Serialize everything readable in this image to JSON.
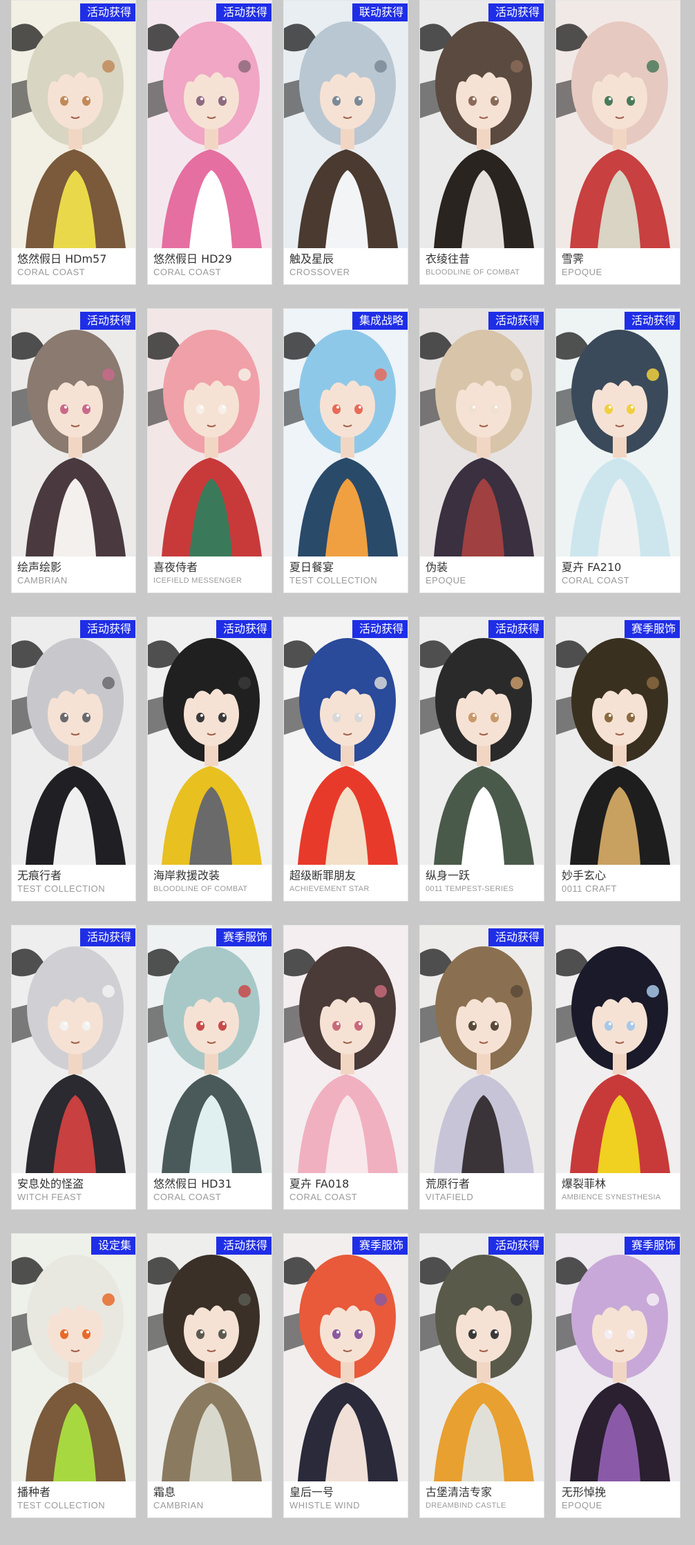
{
  "skins": [
    {
      "name": "悠然假日 HDm57",
      "series": "CORAL COAST",
      "tag": "活动获得",
      "palette": [
        "#f2efe4",
        "#d8d5c2",
        "#7a5a3a",
        "#e9d94a",
        "#c28a5a"
      ]
    },
    {
      "name": "悠然假日 HD29",
      "series": "CORAL COAST",
      "tag": "活动获得",
      "palette": [
        "#f4e8ee",
        "#f0a6c4",
        "#e56fa0",
        "#ffffff",
        "#8e6a7e"
      ]
    },
    {
      "name": "触及星辰",
      "series": "CROSSOVER",
      "tag": "联动获得",
      "palette": [
        "#e8eef2",
        "#b9c7d2",
        "#4a3a30",
        "#f2f4f6",
        "#7b8a98"
      ]
    },
    {
      "name": "衣绫往昔",
      "series": "BLOODLINE OF COMBAT",
      "tag": "活动获得",
      "palette": [
        "#eaeaea",
        "#5a4a40",
        "#2a2420",
        "#e8e2de",
        "#8a6a58"
      ]
    },
    {
      "name": "雪霁",
      "series": "EPOQUE",
      "tag": "",
      "palette": [
        "#f1e9e6",
        "#e6c9c0",
        "#c84040",
        "#d9d4c4",
        "#4a7a5a"
      ]
    },
    {
      "name": "绘声绘影",
      "series": "CAMBRIAN",
      "tag": "活动获得",
      "palette": [
        "#ecebea",
        "#8a7a70",
        "#4a3a40",
        "#f4f0ee",
        "#c86a8a"
      ]
    },
    {
      "name": "喜夜侍者",
      "series": "ICEFIELD MESSENGER",
      "tag": "",
      "palette": [
        "#f3e6e6",
        "#f0a0a8",
        "#c83a3a",
        "#3a7a5a",
        "#f6f0e8"
      ]
    },
    {
      "name": "夏日餐宴",
      "series": "TEST COLLECTION",
      "tag": "集成战略",
      "palette": [
        "#eef4f8",
        "#8ec8e8",
        "#2a4a6a",
        "#f0a040",
        "#e86a5a"
      ]
    },
    {
      "name": "伪装",
      "series": "EPOQUE",
      "tag": "活动获得",
      "palette": [
        "#e6e3e2",
        "#d8c4a8",
        "#3a3040",
        "#a04040",
        "#f0e0d0"
      ]
    },
    {
      "name": "夏卉 FA210",
      "series": "CORAL COAST",
      "tag": "活动获得",
      "palette": [
        "#eef4f4",
        "#3a4a5a",
        "#cde6ee",
        "#f2f2f2",
        "#f0d040"
      ]
    },
    {
      "name": "无痕行者",
      "series": "TEST COLLECTION",
      "tag": "活动获得",
      "palette": [
        "#ededed",
        "#c8c8cc",
        "#202024",
        "#f0f0f0",
        "#6a6a6e"
      ]
    },
    {
      "name": "海岸救援改装",
      "series": "BLOODLINE OF COMBAT",
      "tag": "活动获得",
      "palette": [
        "#f0f0f0",
        "#202020",
        "#e8c020",
        "#6a6a6a",
        "#3a3a3a"
      ]
    },
    {
      "name": "超级断罪朋友",
      "series": "ACHIEVEMENT STAR",
      "tag": "活动获得",
      "palette": [
        "#f4f4f4",
        "#2a4a9a",
        "#e83a2a",
        "#f4e0c8",
        "#d8d8d8"
      ]
    },
    {
      "name": "纵身一跃",
      "series": "0011 TEMPEST-SERIES",
      "tag": "活动获得",
      "palette": [
        "#eeeeee",
        "#2a2a2a",
        "#4a5a4a",
        "#ffffff",
        "#c89a6a"
      ]
    },
    {
      "name": "妙手玄心",
      "series": "0011 CRAFT",
      "tag": "赛季服饰",
      "palette": [
        "#ececec",
        "#3a3020",
        "#1e1e1e",
        "#c8a060",
        "#8a6a40"
      ]
    },
    {
      "name": "安息处的怪盗",
      "series": "WITCH FEAST",
      "tag": "活动获得",
      "palette": [
        "#eeeeee",
        "#d0d0d4",
        "#2a2a30",
        "#c84040",
        "#f2f2f2"
      ]
    },
    {
      "name": "悠然假日 HD31",
      "series": "CORAL COAST",
      "tag": "赛季服饰",
      "palette": [
        "#eef2f2",
        "#a8c8c8",
        "#4a5a5a",
        "#e0f0f0",
        "#c84a4a"
      ]
    },
    {
      "name": "夏卉 FA018",
      "series": "CORAL COAST",
      "tag": "",
      "palette": [
        "#f4eef0",
        "#4a3a38",
        "#f0b0c0",
        "#f8e8ec",
        "#c86a7a"
      ]
    },
    {
      "name": "荒原行者",
      "series": "VITAFIELD",
      "tag": "活动获得",
      "palette": [
        "#eeecea",
        "#8a7050",
        "#c8c4d8",
        "#3a3438",
        "#5a4a3a"
      ]
    },
    {
      "name": "爆裂菲林",
      "series": "AMBIENCE SYNESTHESIA",
      "tag": "",
      "palette": [
        "#f0eeee",
        "#1a1a2a",
        "#c83a3a",
        "#f0d020",
        "#a8c8e8"
      ]
    },
    {
      "name": "播种者",
      "series": "TEST COLLECTION",
      "tag": "设定集",
      "palette": [
        "#eef0ea",
        "#e8e8e0",
        "#7a5a3a",
        "#a8d840",
        "#e86a2a"
      ]
    },
    {
      "name": "霜息",
      "series": "CAMBRIAN",
      "tag": "活动获得",
      "palette": [
        "#eeeeec",
        "#3a3028",
        "#8a7a60",
        "#d8d8cc",
        "#5a5a50"
      ]
    },
    {
      "name": "皇后一号",
      "series": "WHISTLE WIND",
      "tag": "赛季服饰",
      "palette": [
        "#f2eeee",
        "#e85a3a",
        "#2a2a3a",
        "#f0e0d8",
        "#8a5aa0"
      ]
    },
    {
      "name": "古堡清洁专家",
      "series": "DREAMBIND CASTLE",
      "tag": "活动获得",
      "palette": [
        "#ececec",
        "#5a5a4a",
        "#e8a030",
        "#e0e0d8",
        "#3a3a3a"
      ]
    },
    {
      "name": "无形悼挽",
      "series": "EPOQUE",
      "tag": "赛季服饰",
      "palette": [
        "#eeeaf0",
        "#c8a8d8",
        "#2a2030",
        "#8a5aa8",
        "#f4eef4"
      ]
    }
  ]
}
